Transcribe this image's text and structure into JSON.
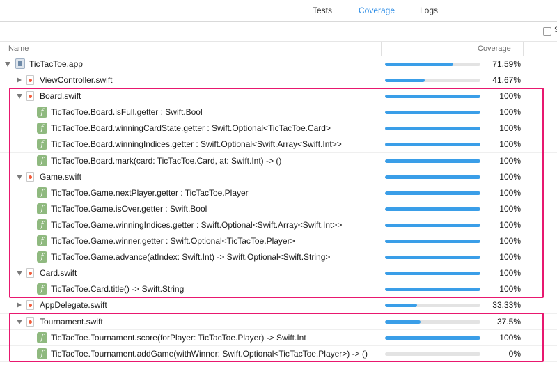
{
  "tabs": [
    {
      "label": "Tests",
      "active": false
    },
    {
      "label": "Coverage",
      "active": true
    },
    {
      "label": "Logs",
      "active": false
    }
  ],
  "options": {
    "checkbox_label": "S"
  },
  "columns": {
    "name": "Name",
    "coverage": "Coverage"
  },
  "colors": {
    "accent": "#2f8ee6",
    "bar_fill": "#3a9ee8",
    "highlight_box": "#e8186f",
    "func_icon": "#8fb97f"
  },
  "rows": [
    {
      "kind": "app",
      "level": 0,
      "disclosure": "open",
      "name": "TicTacToe.app",
      "coverage": "71.59%",
      "fraction": 0.7159
    },
    {
      "kind": "file",
      "level": 1,
      "disclosure": "closed",
      "name": "ViewController.swift",
      "coverage": "41.67%",
      "fraction": 0.4167
    },
    {
      "kind": "file",
      "level": 1,
      "disclosure": "open",
      "name": "Board.swift",
      "coverage": "100%",
      "fraction": 1.0
    },
    {
      "kind": "func",
      "level": 2,
      "disclosure": "none",
      "name": "TicTacToe.Board.isFull.getter : Swift.Bool",
      "coverage": "100%",
      "fraction": 1.0
    },
    {
      "kind": "func",
      "level": 2,
      "disclosure": "none",
      "name": "TicTacToe.Board.winningCardState.getter : Swift.Optional<TicTacToe.Card>",
      "coverage": "100%",
      "fraction": 1.0
    },
    {
      "kind": "func",
      "level": 2,
      "disclosure": "none",
      "name": "TicTacToe.Board.winningIndices.getter : Swift.Optional<Swift.Array<Swift.Int>>",
      "coverage": "100%",
      "fraction": 1.0
    },
    {
      "kind": "func",
      "level": 2,
      "disclosure": "none",
      "name": "TicTacToe.Board.mark(card: TicTacToe.Card, at: Swift.Int) -> ()",
      "coverage": "100%",
      "fraction": 1.0
    },
    {
      "kind": "file",
      "level": 1,
      "disclosure": "open",
      "name": "Game.swift",
      "coverage": "100%",
      "fraction": 1.0
    },
    {
      "kind": "func",
      "level": 2,
      "disclosure": "none",
      "name": "TicTacToe.Game.nextPlayer.getter : TicTacToe.Player",
      "coverage": "100%",
      "fraction": 1.0
    },
    {
      "kind": "func",
      "level": 2,
      "disclosure": "none",
      "name": "TicTacToe.Game.isOver.getter : Swift.Bool",
      "coverage": "100%",
      "fraction": 1.0
    },
    {
      "kind": "func",
      "level": 2,
      "disclosure": "none",
      "name": "TicTacToe.Game.winningIndices.getter : Swift.Optional<Swift.Array<Swift.Int>>",
      "coverage": "100%",
      "fraction": 1.0
    },
    {
      "kind": "func",
      "level": 2,
      "disclosure": "none",
      "name": "TicTacToe.Game.winner.getter : Swift.Optional<TicTacToe.Player>",
      "coverage": "100%",
      "fraction": 1.0
    },
    {
      "kind": "func",
      "level": 2,
      "disclosure": "none",
      "name": "TicTacToe.Game.advance(atIndex: Swift.Int) -> Swift.Optional<Swift.String>",
      "coverage": "100%",
      "fraction": 1.0
    },
    {
      "kind": "file",
      "level": 1,
      "disclosure": "open",
      "name": "Card.swift",
      "coverage": "100%",
      "fraction": 1.0
    },
    {
      "kind": "func",
      "level": 2,
      "disclosure": "none",
      "name": "TicTacToe.Card.title() -> Swift.String",
      "coverage": "100%",
      "fraction": 1.0
    },
    {
      "kind": "file",
      "level": 1,
      "disclosure": "closed",
      "name": "AppDelegate.swift",
      "coverage": "33.33%",
      "fraction": 0.3333
    },
    {
      "kind": "file",
      "level": 1,
      "disclosure": "open",
      "name": "Tournament.swift",
      "coverage": "37.5%",
      "fraction": 0.375
    },
    {
      "kind": "func",
      "level": 2,
      "disclosure": "none",
      "name": "TicTacToe.Tournament.score(forPlayer: TicTacToe.Player) -> Swift.Int",
      "coverage": "100%",
      "fraction": 1.0
    },
    {
      "kind": "func",
      "level": 2,
      "disclosure": "none",
      "name": "TicTacToe.Tournament.addGame(withWinner: Swift.Optional<TicTacToe.Player>) -> ()",
      "coverage": "0%",
      "fraction": 0.0
    }
  ]
}
